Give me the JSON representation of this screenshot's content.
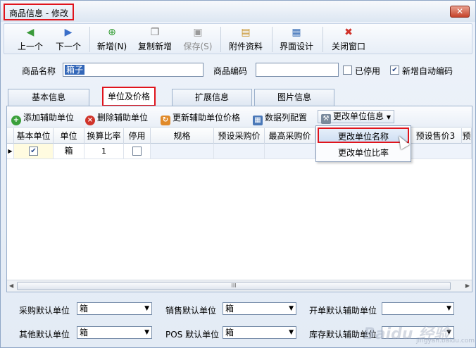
{
  "window": {
    "title": "商品信息 - 修改",
    "close_label": "✕"
  },
  "toolbar": [
    {
      "label": "上一个",
      "icon": "◀"
    },
    {
      "label": "下一个",
      "icon": "▶"
    },
    {
      "label": "新增(N)",
      "icon": "⊕"
    },
    {
      "label": "复制新增",
      "icon": "❐"
    },
    {
      "label": "保存(S)",
      "icon": "▣"
    },
    {
      "label": "附件资料",
      "icon": "▤"
    },
    {
      "label": "界面设计",
      "icon": "▦"
    },
    {
      "label": "关闭窗口",
      "icon": "✖"
    }
  ],
  "form": {
    "name_label": "商品名称",
    "name_value": "箱子",
    "code_label": "商品编码",
    "code_value": "",
    "disabled_label": "已停用",
    "autocode_label": "新增自动编码"
  },
  "tabs": [
    "基本信息",
    "单位及价格",
    "扩展信息",
    "图片信息"
  ],
  "subtoolbar": [
    "添加辅助单位",
    "删除辅助单位",
    "更新辅助单位价格",
    "数据列配置",
    "更改单位信息"
  ],
  "grid": {
    "headers": [
      "基本单位",
      "单位",
      "换算比率",
      "停用",
      "规格",
      "预设采购价",
      "最高采购价",
      "",
      "预设售价3",
      "预"
    ],
    "row": {
      "unit": "箱",
      "ratio": "1"
    }
  },
  "dropdown": [
    "更改单位名称",
    "更改单位比率"
  ],
  "scroll_grip": "III",
  "bottom": {
    "purchase_label": "采购默认单位",
    "purchase_value": "箱",
    "sales_label": "销售默认单位",
    "sales_value": "箱",
    "billing_label": "开单默认辅助单位",
    "billing_value": "",
    "other_label": "其他默认单位",
    "other_value": "箱",
    "pos_label": "POS 默认单位",
    "pos_value": "箱",
    "stock_label": "库存默认辅助单位",
    "stock_value": ""
  },
  "watermark": "Baidu 经验",
  "watermark_url": "jingyan.baidu.com"
}
